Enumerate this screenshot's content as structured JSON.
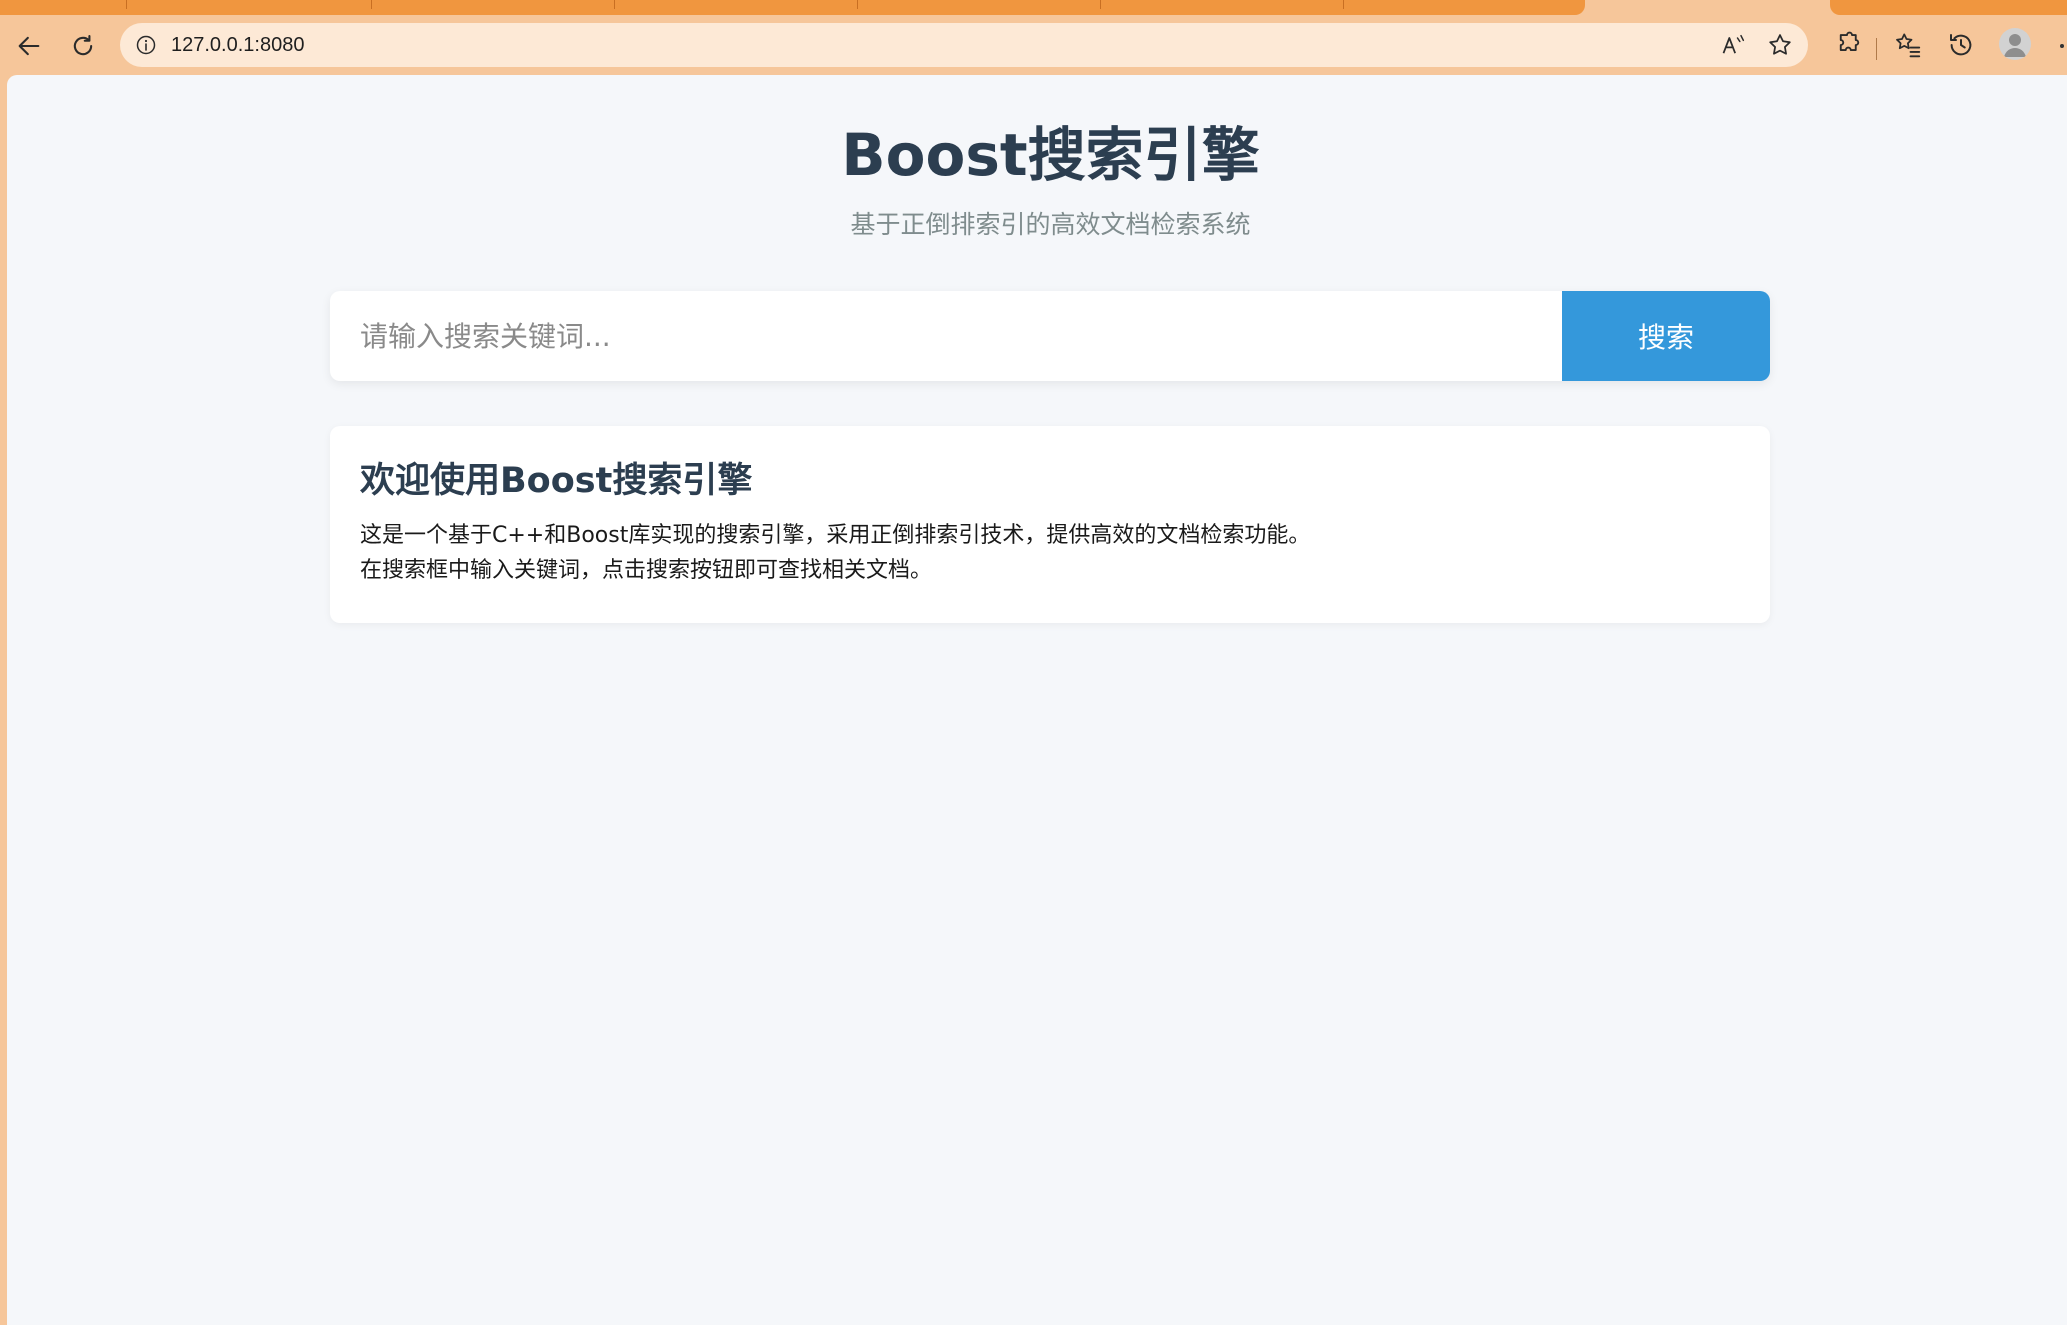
{
  "browser": {
    "url": "127.0.0.1:8080",
    "icons": {
      "back": "arrow-left-icon",
      "reload": "reload-icon",
      "site_info": "info-icon",
      "read_aloud": "read-aloud-icon",
      "favorite": "star-icon",
      "extensions": "puzzle-icon",
      "favorites": "favorites-list-icon",
      "history": "history-icon",
      "profile": "avatar-icon"
    },
    "chrome_color": "#f6c69a",
    "tab_color": "#f0963f"
  },
  "page": {
    "title": "Boost搜索引擎",
    "subtitle": "基于正倒排索引的高效文档检索系统",
    "search": {
      "placeholder": "请输入搜索关键词...",
      "value": "",
      "button_label": "搜索"
    },
    "welcome": {
      "title": "欢迎使用Boost搜索引擎",
      "line1": "这是一个基于C++和Boost库实现的搜索引擎，采用正倒排索引技术，提供高效的文档检索功能。",
      "line2": "在搜索框中输入关键词，点击搜索按钮即可查找相关文档。"
    },
    "colors": {
      "title": "#2c3e50",
      "subtitle": "#7f8c8d",
      "accent": "#3498db",
      "background": "#f5f7fa"
    }
  }
}
